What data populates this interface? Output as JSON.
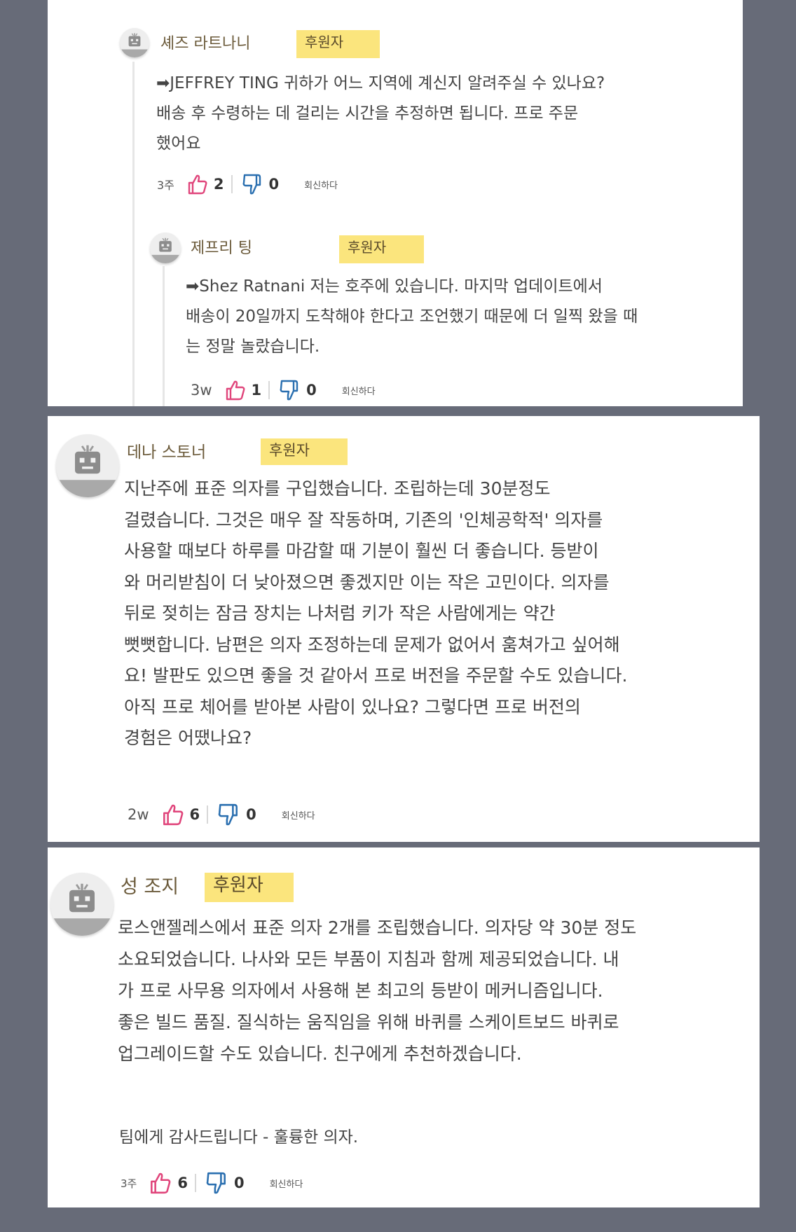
{
  "comments": [
    {
      "author": "셰즈 라트나니",
      "badge": "후원자",
      "lines": [
        "➡JEFFREY TING 귀하가 어느 지역에 계신지 알려주실 수 있나요?",
        "배송 후 수령하는 데 걸리는 시간을 추정하면 됩니다. 프로 주문",
        "했어요"
      ],
      "time": "3주",
      "likes": "2",
      "dislikes": "0",
      "reply": "회신하다"
    },
    {
      "author": "제프리 팅",
      "badge": "후원자",
      "lines": [
        "➡Shez Ratnani 저는 호주에 있습니다. 마지막 업데이트에서",
        "배송이 20일까지 도착해야 한다고 조언했기 때문에 더 일찍 왔을 때",
        "는 정말 놀랐습니다."
      ],
      "time": "3w",
      "likes": "1",
      "dislikes": "0",
      "reply": "회신하다"
    },
    {
      "author": "데나 스토너",
      "badge": "후원자",
      "lines": [
        "지난주에 표준 의자를 구입했습니다. 조립하는데 30분정도",
        "걸렸습니다. 그것은 매우 잘 작동하며, 기존의 '인체공학적' 의자를",
        "사용할 때보다 하루를 마감할 때 기분이 훨씬 더 좋습니다. 등받이",
        "와 머리받침이 더 낮아졌으면 좋겠지만 이는 작은 고민이다. 의자를",
        "뒤로 젖히는 잠금 장치는 나처럼 키가 작은 사람에게는 약간",
        "뻣뻣합니다. 남편은 의자 조정하는데 문제가 없어서 훔쳐가고 싶어해",
        "요! 발판도 있으면 좋을 것 같아서 프로 버전을 주문할 수도 있습니다.",
        "아직 프로 체어를 받아본 사람이 있나요? 그렇다면 프로 버전의",
        "경험은 어땠나요?"
      ],
      "time": "2w",
      "likes": "6",
      "dislikes": "0",
      "reply": "회신하다"
    },
    {
      "author": "성 조지",
      "badge": "후원자",
      "lines": [
        "로스앤젤레스에서 표준 의자 2개를 조립했습니다. 의자당 약 30분 정도",
        "소요되었습니다. 나사와 모든 부품이 지침과 함께 제공되었습니다. 내",
        "가 프로 사무용 의자에서 사용해 본 최고의 등받이 메커니즘입니다.",
        "좋은 빌드 품질. 질식하는 움직임을 위해 바퀴를 스케이트보드 바퀴로",
        "업그레이드할 수도 있습니다. 친구에게 추천하겠습니다."
      ],
      "footer": "팀에게 감사드립니다 -  훌륭한 의자.",
      "time": "3주",
      "likes": "6",
      "dislikes": "0",
      "reply": "회신하다"
    }
  ],
  "colors": {
    "background": "#676b78",
    "badge": "#fbe57d",
    "thumb_up": "#e0457b",
    "thumb_down": "#2a6fb0"
  },
  "icons": {
    "avatar": "robot-avatar-icon",
    "like": "thumbs-up-icon",
    "dislike": "thumbs-down-icon"
  }
}
